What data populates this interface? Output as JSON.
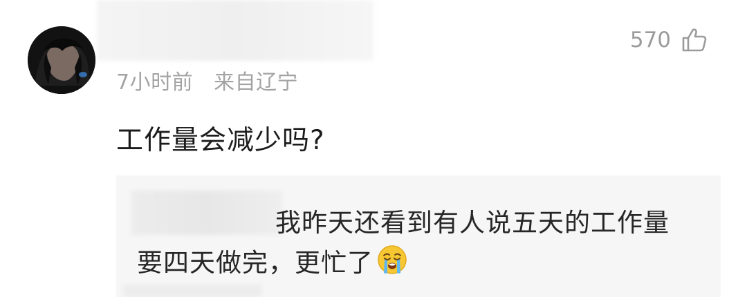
{
  "comment": {
    "time": "7小时前",
    "location": "来自辽宁",
    "text": "工作量会减少吗?",
    "likes": "570"
  },
  "reply": {
    "text": "我昨天还看到有人说五天的工作量要四天做完，更忙了"
  },
  "icons": {
    "like": "thumbs-up-outline-icon",
    "emoji": "loudly-crying-face-emoji"
  }
}
